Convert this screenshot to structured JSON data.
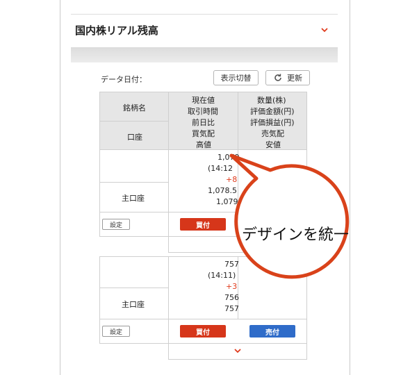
{
  "section": {
    "title": "国内株リアル残高"
  },
  "toolbar": {
    "date_label": "データ日付：",
    "switch_label": "表示切替",
    "update_label": "更新"
  },
  "table_header": {
    "col1_top": "銘柄名",
    "col1_bottom": "口座",
    "col2": [
      "現在値",
      "取引時間",
      "前日比",
      "買気配",
      "高値"
    ],
    "col3": [
      "数量(株)",
      "評価金額(円)",
      "評価損益(円)",
      "売気配",
      "安値"
    ]
  },
  "rows": [
    {
      "account": "主口座",
      "values": [
        "1,079",
        "(14:12",
        "+8",
        "1,078.5",
        "1,079"
      ],
      "settings_label": "設定",
      "buy_label": "買付"
    },
    {
      "account": "主口座",
      "values": [
        "757",
        "(14:11)",
        "+3",
        "756",
        "757"
      ],
      "settings_label": "設定",
      "buy_label": "買付",
      "sell_label": "売付"
    }
  ],
  "callout": {
    "text": "デザインを統一"
  },
  "colors": {
    "accent_red": "#e03a1c",
    "buy": "#d6361a",
    "sell": "#2f6cc9",
    "callout_border": "#d9421a"
  },
  "icons": {
    "collapse": "chevron-down-icon",
    "refresh": "refresh-icon",
    "more": "chevron-down-icon"
  }
}
